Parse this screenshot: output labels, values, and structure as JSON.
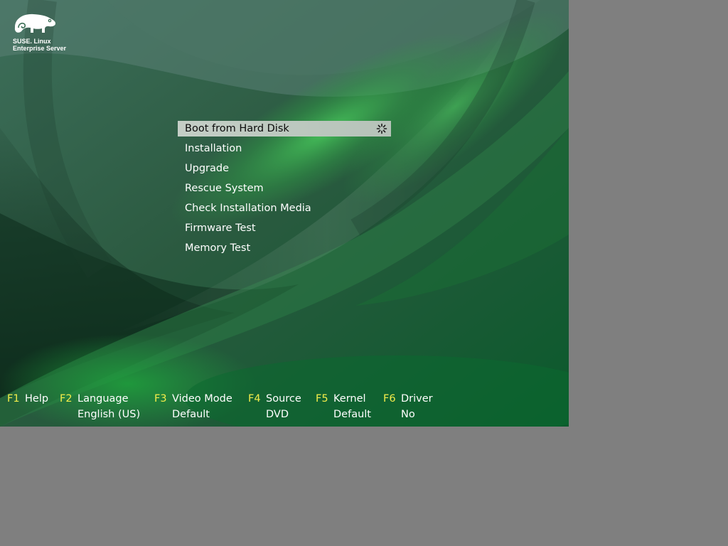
{
  "screen": {
    "colors": {
      "background_dark": "#17452c",
      "accent_green": "#3cae52",
      "desktop_gray": "#7f7f7f",
      "fkey_yellow": "#f2ec4a",
      "selection": "#c0cbc2"
    }
  },
  "logo": {
    "icon": "chameleon-icon",
    "line1": "SUSE. Linux",
    "line2": "Enterprise Server"
  },
  "menu": {
    "selected_index": 0,
    "items": [
      {
        "label": "Boot from Hard Disk"
      },
      {
        "label": "Installation"
      },
      {
        "label": "Upgrade"
      },
      {
        "label": "Rescue System"
      },
      {
        "label": "Check Installation Media"
      },
      {
        "label": "Firmware Test"
      },
      {
        "label": "Memory Test"
      }
    ],
    "busy_icon": "spinner-icon"
  },
  "function_keys": [
    {
      "key": "F1",
      "label": "Help",
      "value": ""
    },
    {
      "key": "F2",
      "label": "Language",
      "value": "English (US)"
    },
    {
      "key": "F3",
      "label": "Video Mode",
      "value": "Default"
    },
    {
      "key": "F4",
      "label": "Source",
      "value": "DVD"
    },
    {
      "key": "F5",
      "label": "Kernel",
      "value": "Default"
    },
    {
      "key": "F6",
      "label": "Driver",
      "value": "No"
    }
  ]
}
